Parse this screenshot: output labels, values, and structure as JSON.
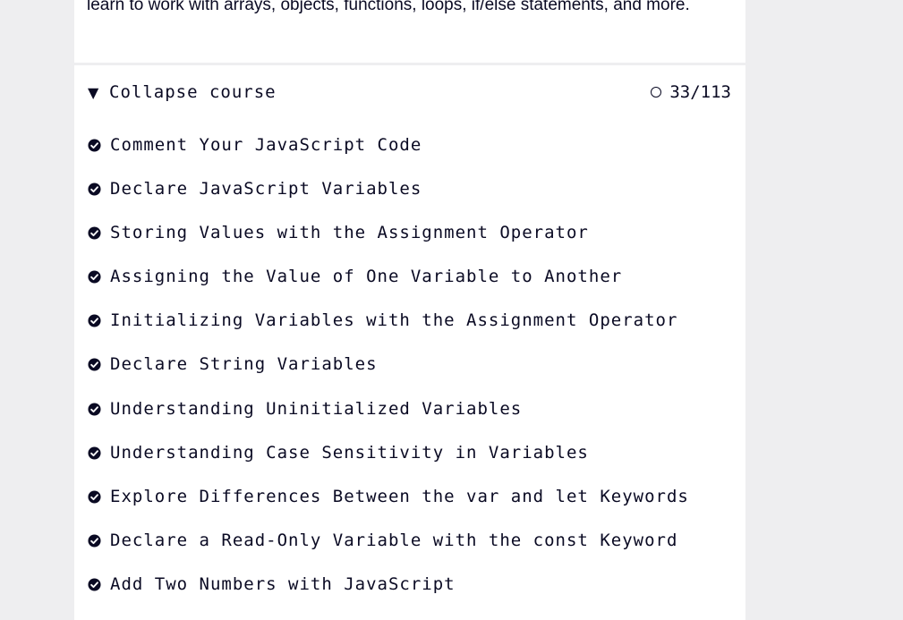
{
  "intro": {
    "text": "learn to work with arrays, objects, functions, loops, if/else statements, and more."
  },
  "course": {
    "toggle_symbol": "▼",
    "collapse_label": "Collapse course",
    "progress": "33/113",
    "challenges": [
      {
        "label": "Comment Your JavaScript Code",
        "completed": true
      },
      {
        "label": "Declare JavaScript Variables",
        "completed": true
      },
      {
        "label": "Storing Values with the Assignment Operator",
        "completed": true
      },
      {
        "label": "Assigning the Value of One Variable to Another",
        "completed": true
      },
      {
        "label": "Initializing Variables with the Assignment Operator",
        "completed": true
      },
      {
        "label": "Declare String Variables",
        "completed": true
      },
      {
        "label": "Understanding Uninitialized Variables",
        "completed": true
      },
      {
        "label": "Understanding Case Sensitivity in Variables",
        "completed": true
      },
      {
        "label": "Explore Differences Between the var and let Keywords",
        "completed": true
      },
      {
        "label": "Declare a Read-Only Variable with the const Keyword",
        "completed": true
      },
      {
        "label": "Add Two Numbers with JavaScript",
        "completed": true
      }
    ]
  },
  "icons": {
    "completed": "check-circle-icon",
    "progress": "circle-outline-icon",
    "toggle": "triangle-down-icon"
  },
  "colors": {
    "text": "#0a0a23",
    "page_background": "#eeeef0",
    "panel_background": "#ffffff"
  }
}
